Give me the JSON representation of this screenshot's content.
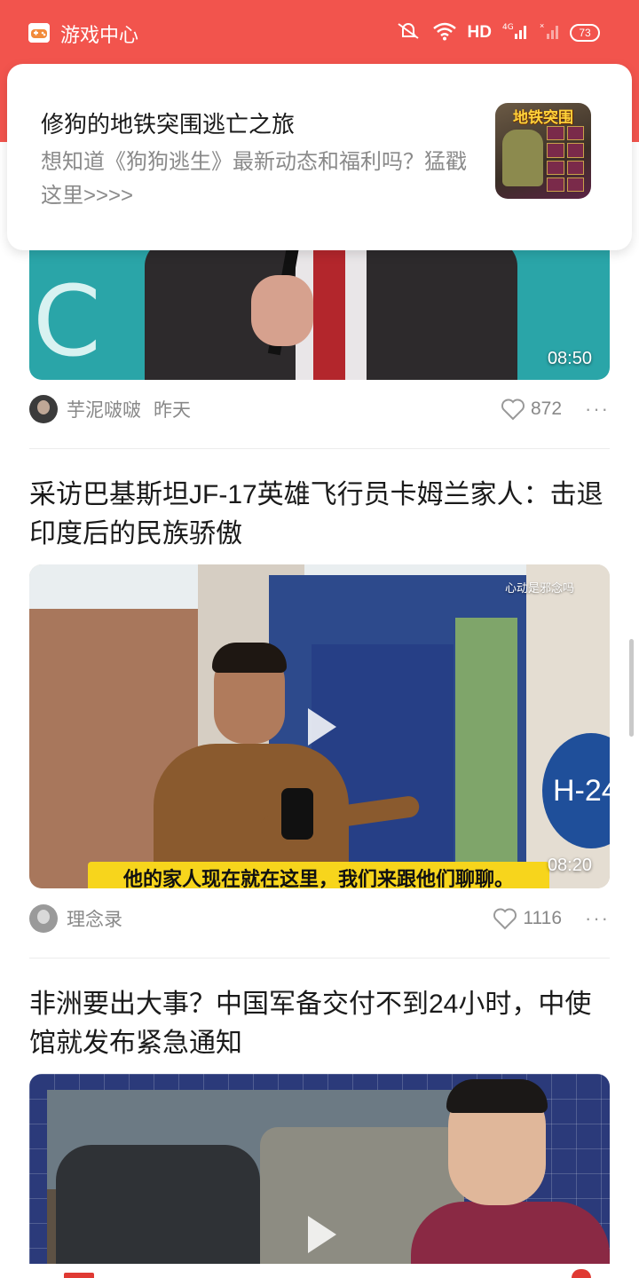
{
  "status_bar": {
    "app_name": "游戏中心",
    "network": "HD",
    "signal": "4G",
    "battery": "73"
  },
  "notification": {
    "title": "修狗的地铁突围逃亡之旅",
    "body": "想知道《狗狗逃生》最新动态和福利吗？猛戳这里>>>>",
    "thumbnail_text": "地铁突围"
  },
  "feed": {
    "items": [
      {
        "duration": "08:50",
        "author": "芋泥啵啵",
        "time": "昨天",
        "likes": "872"
      },
      {
        "title": "采访巴基斯坦JF-17英雄飞行员卡姆兰家人：击退印度后的民族骄傲",
        "duration": "08:20",
        "caption": "他的家人现在就在这里，我们来跟他们聊聊。",
        "watermark": "心动是邪念吗",
        "sign_text": "H-24",
        "author": "理念录",
        "likes": "1116"
      },
      {
        "title": "非洲要出大事？中国军备交付不到24小时，中使馆就发布紧急通知"
      }
    ]
  },
  "colors": {
    "header_red": "#f2544d",
    "accent_red": "#e03a33",
    "meta_gray": "#888888"
  },
  "icons": {
    "like": "heart-outline-icon",
    "more": "more-dots-icon",
    "play": "play-icon"
  }
}
